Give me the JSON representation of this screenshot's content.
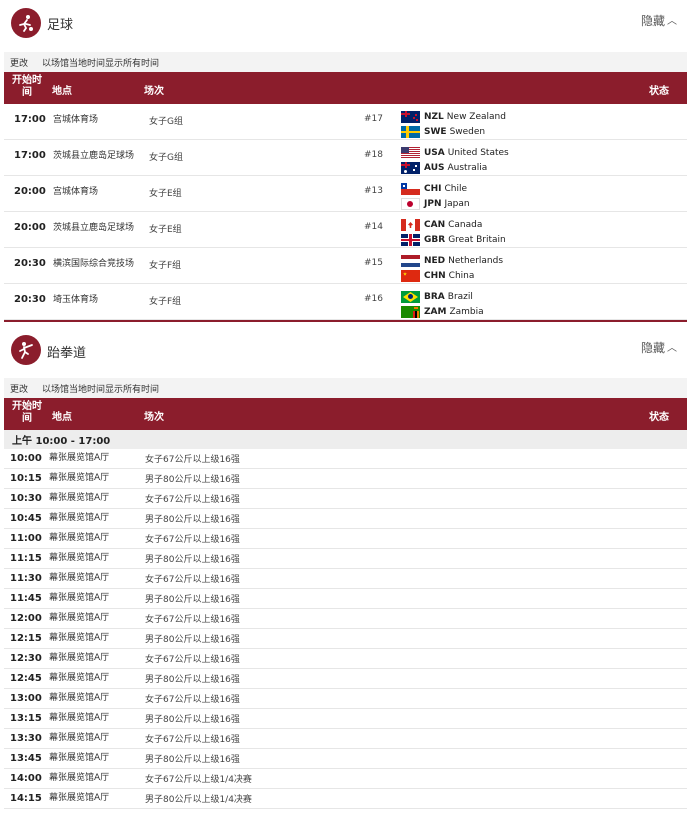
{
  "soccer": {
    "title": "足球",
    "hide_label": "隐藏",
    "tz_change": "更改",
    "tz_text": "以场馆当地时间显示所有时间",
    "headers": {
      "time": "开始时间",
      "venue": "地点",
      "event": "场次",
      "status": "状态"
    },
    "matches": [
      {
        "time": "17:00",
        "venue": "宫城体育场",
        "event": "女子G组",
        "num": "#17",
        "team1": {
          "code": "NZL",
          "name": "New Zealand",
          "flag": "nzl"
        },
        "team2": {
          "code": "SWE",
          "name": "Sweden",
          "flag": "swe"
        }
      },
      {
        "time": "17:00",
        "venue": "茨城县立鹿岛足球场",
        "event": "女子G组",
        "num": "#18",
        "team1": {
          "code": "USA",
          "name": "United States",
          "flag": "usa"
        },
        "team2": {
          "code": "AUS",
          "name": "Australia",
          "flag": "aus"
        }
      },
      {
        "time": "20:00",
        "venue": "宫城体育场",
        "event": "女子E组",
        "num": "#13",
        "team1": {
          "code": "CHI",
          "name": "Chile",
          "flag": "chi"
        },
        "team2": {
          "code": "JPN",
          "name": "Japan",
          "flag": "jpn"
        }
      },
      {
        "time": "20:00",
        "venue": "茨城县立鹿岛足球场",
        "event": "女子E组",
        "num": "#14",
        "team1": {
          "code": "CAN",
          "name": "Canada",
          "flag": "can"
        },
        "team2": {
          "code": "GBR",
          "name": "Great Britain",
          "flag": "gbr"
        }
      },
      {
        "time": "20:30",
        "venue": "横滨国际综合竞技场",
        "event": "女子F组",
        "num": "#15",
        "team1": {
          "code": "NED",
          "name": "Netherlands",
          "flag": "ned"
        },
        "team2": {
          "code": "CHN",
          "name": "China",
          "flag": "chn"
        }
      },
      {
        "time": "20:30",
        "venue": "埼玉体育场",
        "event": "女子F组",
        "num": "#16",
        "team1": {
          "code": "BRA",
          "name": "Brazil",
          "flag": "bra"
        },
        "team2": {
          "code": "ZAM",
          "name": "Zambia",
          "flag": "zam"
        }
      }
    ]
  },
  "taekwondo": {
    "title": "跆拳道",
    "hide_label": "隐藏",
    "tz_change": "更改",
    "tz_text": "以场馆当地时间显示所有时间",
    "headers": {
      "time": "开始时间",
      "venue": "地点",
      "event": "场次",
      "status": "状态"
    },
    "session": "上午  10:00 - 17:00",
    "rows": [
      {
        "time": "10:00",
        "venue": "幕张展览馆A厅",
        "event": "女子67公斤以上级16强"
      },
      {
        "time": "10:15",
        "venue": "幕张展览馆A厅",
        "event": "男子80公斤以上级16强"
      },
      {
        "time": "10:30",
        "venue": "幕张展览馆A厅",
        "event": "女子67公斤以上级16强"
      },
      {
        "time": "10:45",
        "venue": "幕张展览馆A厅",
        "event": "男子80公斤以上级16强"
      },
      {
        "time": "11:00",
        "venue": "幕张展览馆A厅",
        "event": "女子67公斤以上级16强"
      },
      {
        "time": "11:15",
        "venue": "幕张展览馆A厅",
        "event": "男子80公斤以上级16强"
      },
      {
        "time": "11:30",
        "venue": "幕张展览馆A厅",
        "event": "女子67公斤以上级16强"
      },
      {
        "time": "11:45",
        "venue": "幕张展览馆A厅",
        "event": "男子80公斤以上级16强"
      },
      {
        "time": "12:00",
        "venue": "幕张展览馆A厅",
        "event": "女子67公斤以上级16强"
      },
      {
        "time": "12:15",
        "venue": "幕张展览馆A厅",
        "event": "男子80公斤以上级16强"
      },
      {
        "time": "12:30",
        "venue": "幕张展览馆A厅",
        "event": "女子67公斤以上级16强"
      },
      {
        "time": "12:45",
        "venue": "幕张展览馆A厅",
        "event": "男子80公斤以上级16强"
      },
      {
        "time": "13:00",
        "venue": "幕张展览馆A厅",
        "event": "女子67公斤以上级16强"
      },
      {
        "time": "13:15",
        "venue": "幕张展览馆A厅",
        "event": "男子80公斤以上级16强"
      },
      {
        "time": "13:30",
        "venue": "幕张展览馆A厅",
        "event": "女子67公斤以上级16强"
      },
      {
        "time": "13:45",
        "venue": "幕张展览馆A厅",
        "event": "男子80公斤以上级16强"
      },
      {
        "time": "14:00",
        "venue": "幕张展览馆A厅",
        "event": "女子67公斤以上级1/4决赛"
      },
      {
        "time": "14:15",
        "venue": "幕张展览馆A厅",
        "event": "男子80公斤以上级1/4决赛"
      }
    ]
  },
  "colors": {
    "accent": "#8b1d2c"
  }
}
